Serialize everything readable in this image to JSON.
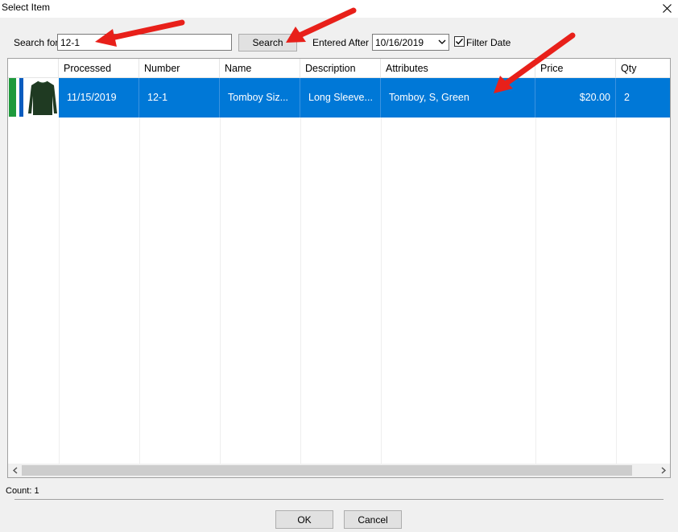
{
  "window": {
    "title": "Select Item"
  },
  "toolbar": {
    "search_label": "Search for",
    "search_value": "12-1",
    "search_button": "Search",
    "entered_after_label": "Entered After",
    "entered_after_value": "10/16/2019",
    "filter_date_label": "Filter Date",
    "filter_date_checked": true
  },
  "grid": {
    "columns": [
      "Processed",
      "Number",
      "Name",
      "Description",
      "Attributes",
      "Price",
      "Qty"
    ],
    "sort_column": "Processed",
    "rows": [
      {
        "processed": "11/15/2019",
        "number": "12-1",
        "name": "Tomboy Siz...",
        "description": "Long Sleeve...",
        "attributes": "Tomboy, S, Green",
        "price": "$20.00",
        "qty": "2",
        "thumbnail": "green-long-sleeve-shirt-icon"
      }
    ]
  },
  "footer": {
    "count": "Count: 1",
    "ok_button": "OK",
    "cancel_button": "Cancel"
  },
  "colors": {
    "selection": "#0078d7",
    "annotation_arrow": "#e8201a",
    "status_green": "#1e9a3c"
  }
}
